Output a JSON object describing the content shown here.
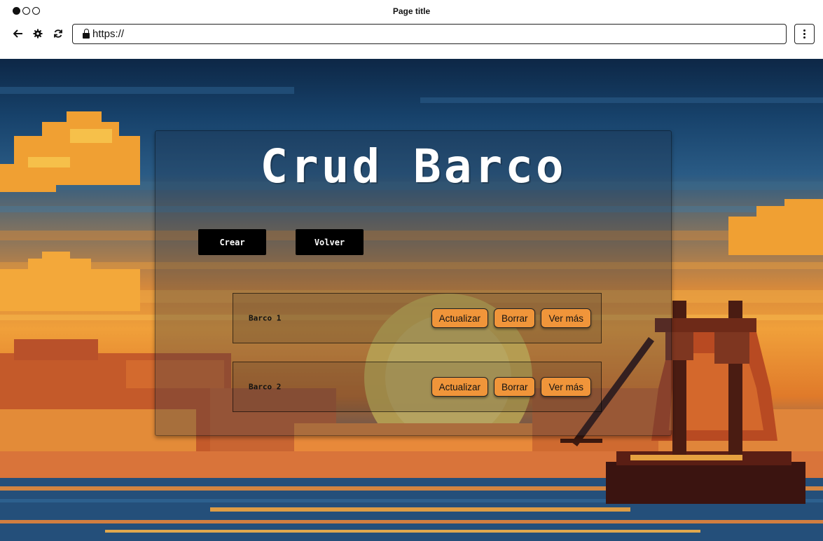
{
  "browser": {
    "title": "Page title",
    "url": "https://",
    "icons": [
      "back-arrow-icon",
      "settings-gear-icon",
      "reload-icon",
      "lock-icon",
      "kebab-menu-icon"
    ]
  },
  "app": {
    "title": "Crud Barco",
    "toolbar": {
      "create_label": "Crear",
      "back_label": "Volver"
    },
    "boats": [
      {
        "name": "Barco 1",
        "update_label": "Actualizar",
        "delete_label": "Borrar",
        "more_label": "Ver más"
      },
      {
        "name": "Barco 2",
        "update_label": "Actualizar",
        "delete_label": "Borrar",
        "more_label": "Ver más"
      }
    ]
  },
  "colors": {
    "action_button": "#f0953a",
    "primary_button": "#000000",
    "title_text": "#ffffff"
  }
}
